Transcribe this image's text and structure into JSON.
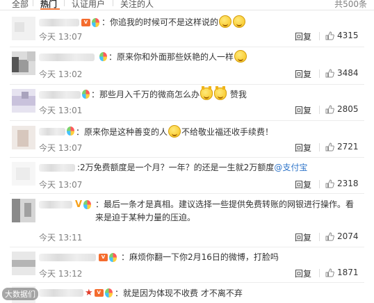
{
  "tabs": [
    {
      "label": "全部",
      "active": false
    },
    {
      "label": "热门",
      "active": true
    },
    {
      "label": "认证用户",
      "active": false
    },
    {
      "label": "关注的人",
      "active": false
    }
  ],
  "total_label": "共500条",
  "reply_label": "回复",
  "like_icon": "thumbs-up-icon",
  "link_color": "#2e74c9",
  "comments": [
    {
      "segments": [
        "：你追我的时候可不是这样说的"
      ],
      "emoji_count": 2,
      "time": "今天 13:07",
      "likes": "4315"
    },
    {
      "segments": [
        "：原来你和外面那些妖艳的人一样"
      ],
      "emoji_count": 1,
      "time": "今天 13:02",
      "likes": "3484"
    },
    {
      "segments": [
        "：那些月入千万的微商怎么办",
        "赞我"
      ],
      "emoji_count": 2,
      "time": "今天 13:01",
      "likes": "2805"
    },
    {
      "segments": [
        "：原来你是这种善变的人",
        "不给敬业福还收手续费！"
      ],
      "emoji_count": 1,
      "time": "今天 13:07",
      "likes": "2721"
    },
    {
      "segments": [
        ":2万免费额度是一个月？一年？的还是一生就2万额度"
      ],
      "link": "@支付宝",
      "time": "今天 13:07",
      "likes": "2318"
    },
    {
      "segments": [
        "：最后一条才是真相。建议选择一些提供免费转账的网银进行操作。看来是迫于某种力量的压迫。"
      ],
      "time": "今天 13:11",
      "likes": "2074"
    },
    {
      "segments": [
        "：麻烦你翻一下你2月16日的微博，打脸吗"
      ],
      "time": "今天 13:12",
      "likes": "1871"
    },
    {
      "segments": [
        "：就是因为体现不收费 才不离不弃"
      ]
    }
  ],
  "watermark": "大数据们"
}
